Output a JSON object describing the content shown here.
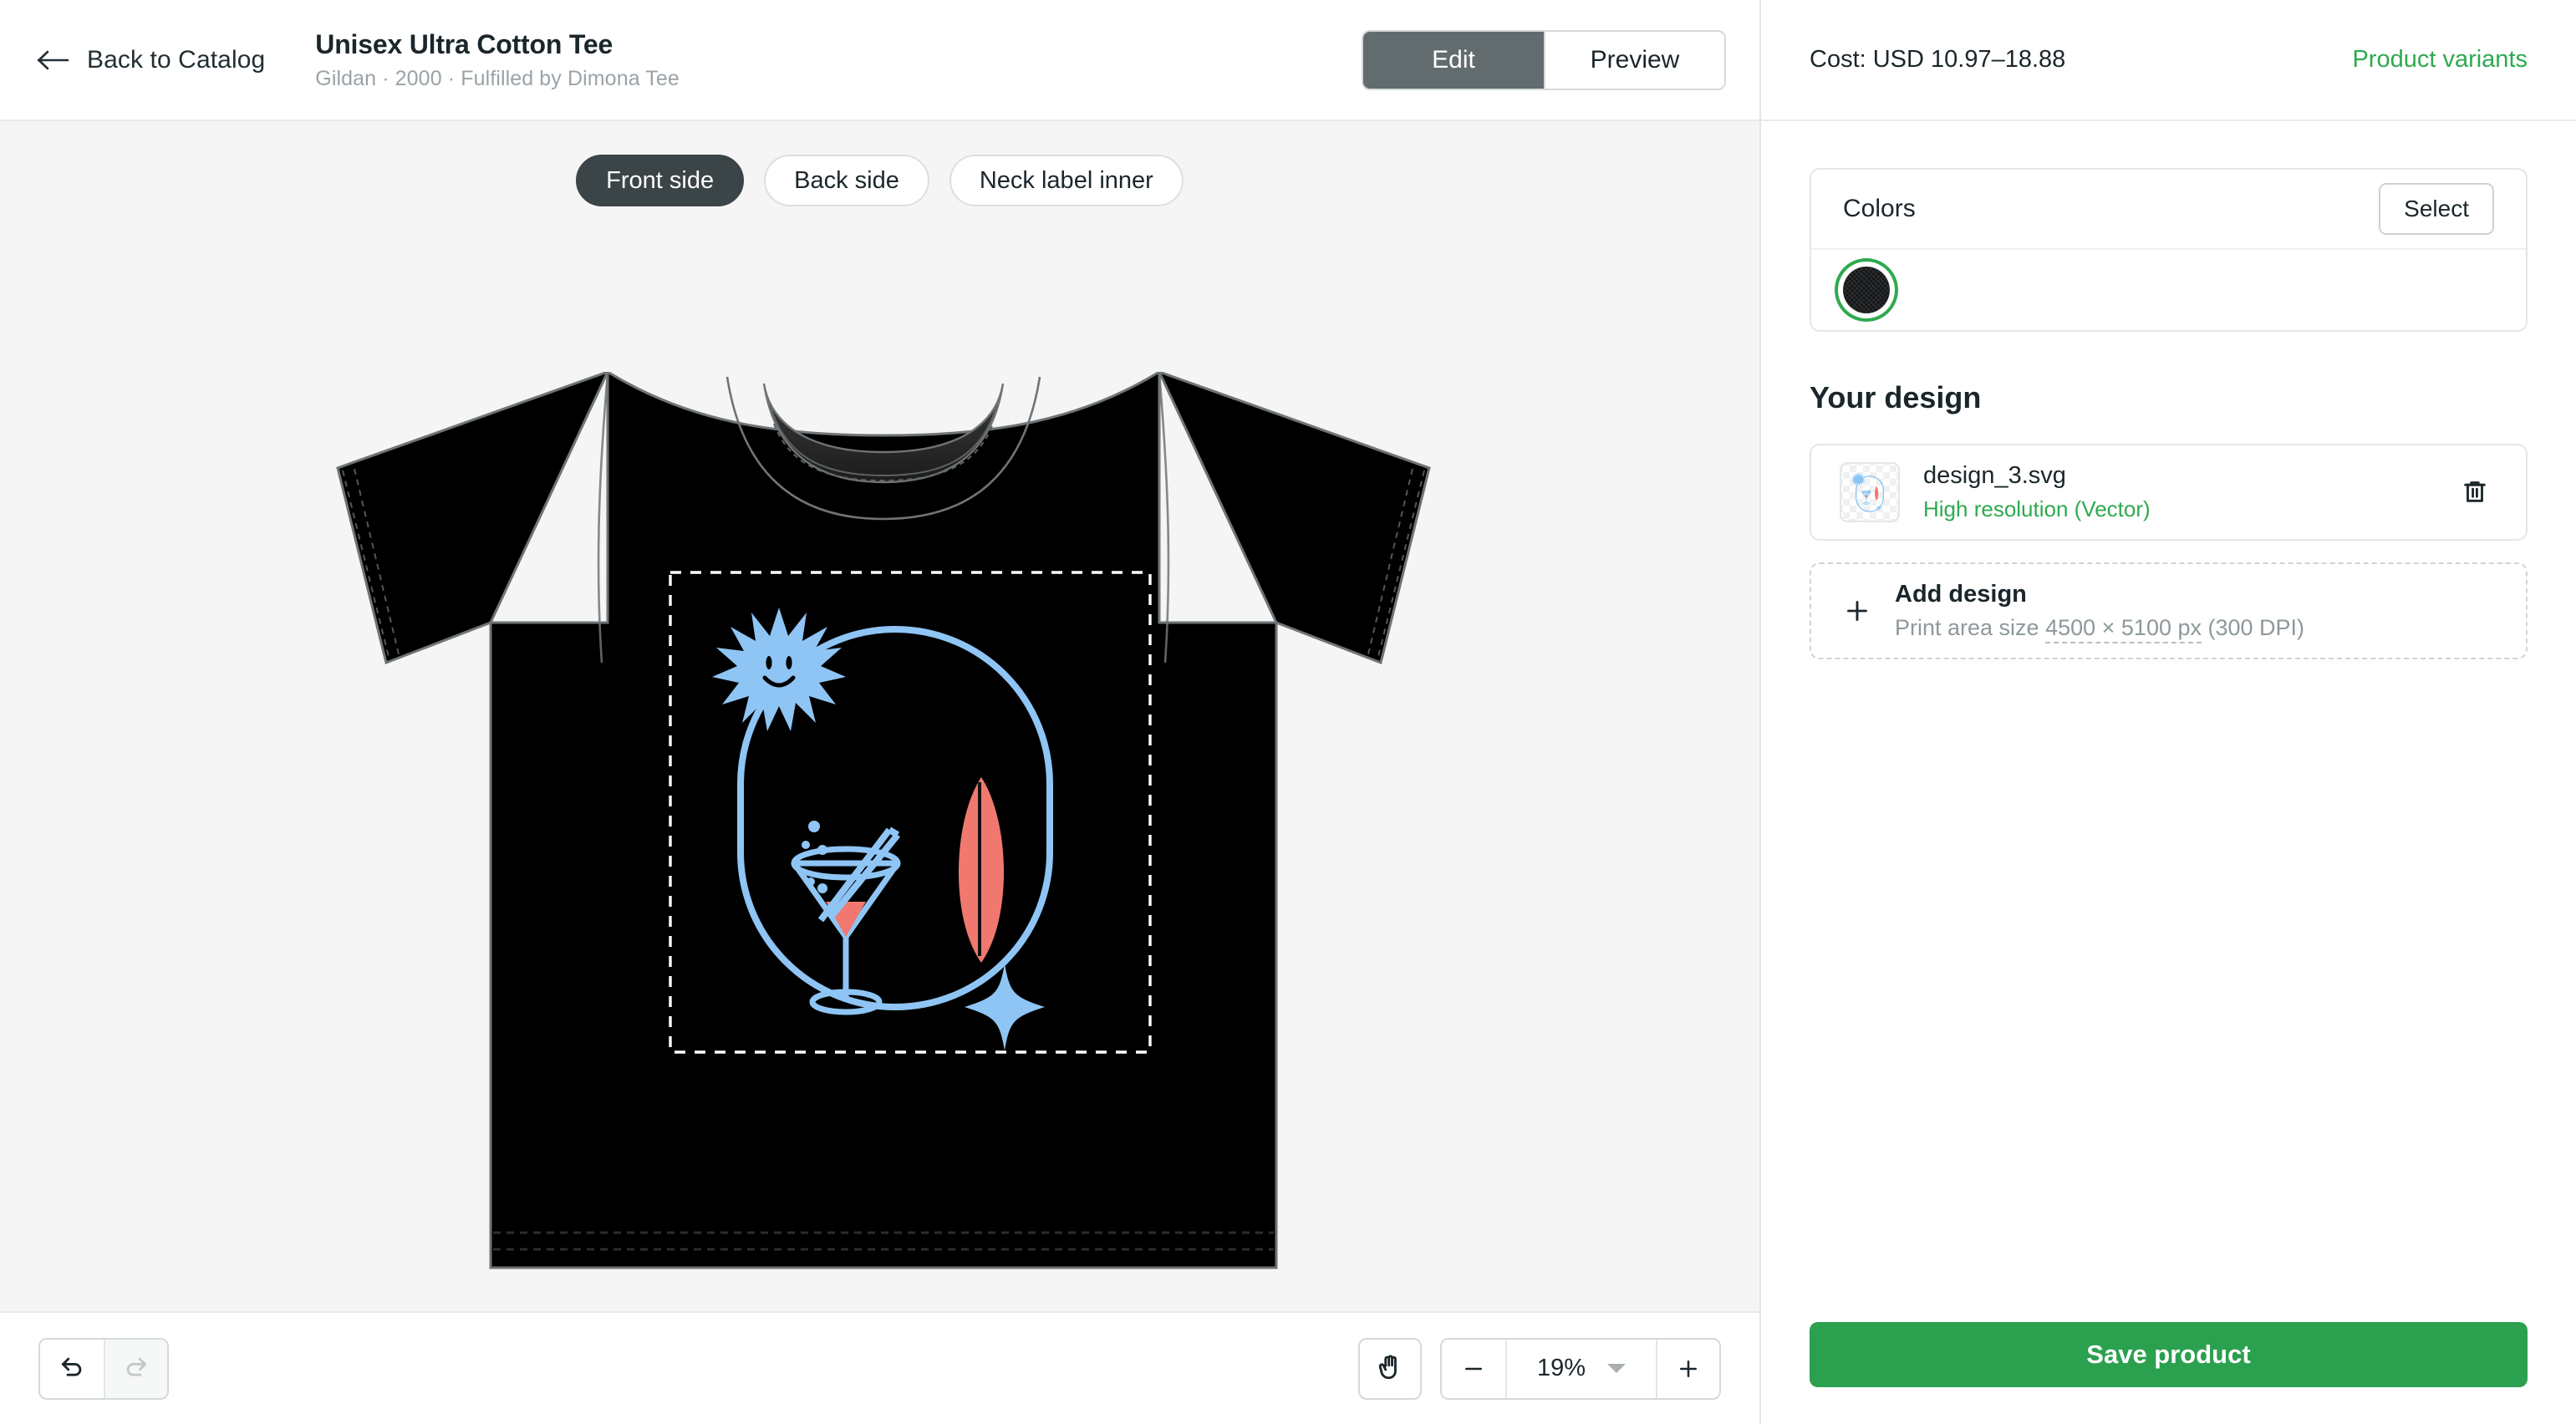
{
  "header": {
    "back_label": "Back to Catalog",
    "product_title": "Unisex Ultra Cotton Tee",
    "product_subtitle": "Gildan · 2000 · Fulfilled by Dimona Tee",
    "mode_tabs": [
      {
        "label": "Edit",
        "active": true
      },
      {
        "label": "Preview",
        "active": false
      }
    ]
  },
  "canvas": {
    "side_tabs": [
      {
        "label": "Front side",
        "active": true
      },
      {
        "label": "Back side",
        "active": false
      },
      {
        "label": "Neck label inner",
        "active": false
      }
    ],
    "garment_color": "#000000",
    "artwork_blue": "#8ec5f5",
    "artwork_red": "#f0786f"
  },
  "toolbar": {
    "undo_icon": "undo-arrow-icon",
    "redo_icon": "redo-arrow-icon",
    "hand_icon": "hand-pan-icon",
    "zoom_out_label": "−",
    "zoom_value": "19%",
    "zoom_in_label": "+"
  },
  "panel": {
    "cost_label": "Cost: USD 10.97–18.88",
    "variants_link": "Product variants",
    "colors": {
      "title": "Colors",
      "select_label": "Select",
      "swatches": [
        {
          "name": "Black",
          "hex": "#111315",
          "selected": true
        }
      ]
    },
    "your_design": {
      "heading": "Your design",
      "file_name": "design_3.svg",
      "resolution_label": "High resolution (Vector)",
      "delete_icon": "trash-icon"
    },
    "add_design": {
      "plus_icon": "plus-icon",
      "title": "Add design",
      "subtitle_prefix": "Print area size ",
      "subtitle_size": "4500 × 5100 px",
      "subtitle_suffix": " (300 DPI)"
    },
    "save_label": "Save product"
  },
  "colors": {
    "green": "#2ba04e",
    "dark": "#1b262b",
    "muted": "#9aa3a7",
    "canvas_bg": "#f5f5f5"
  }
}
